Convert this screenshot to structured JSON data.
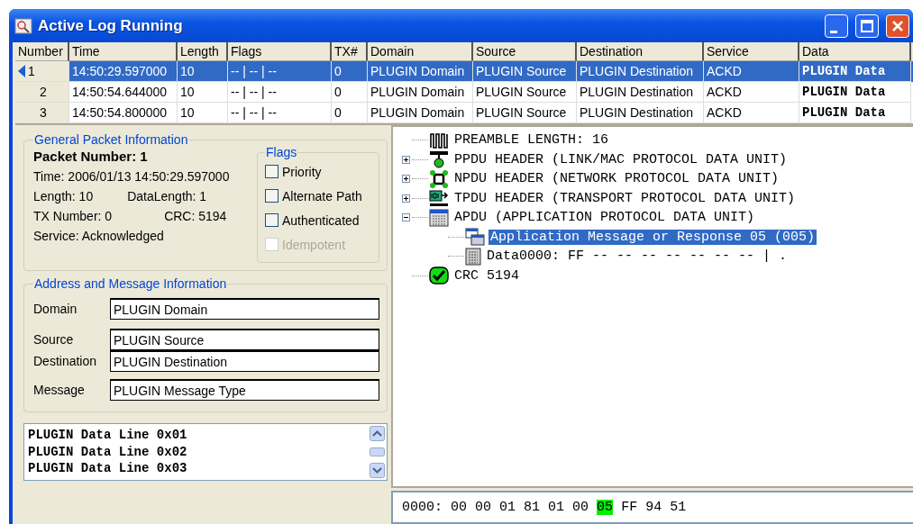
{
  "window": {
    "title": "Active Log Running"
  },
  "table": {
    "columns": [
      "Number",
      "Time",
      "Length",
      "Flags",
      "TX#",
      "Domain",
      "Source",
      "Destination",
      "Service",
      "Data"
    ],
    "rows": [
      {
        "selected": true,
        "cells": [
          "1",
          "14:50:29.597000",
          "10",
          "-- | -- | --",
          "0",
          "PLUGIN Domain",
          "PLUGIN Source",
          "PLUGIN Destination",
          "ACKD",
          "PLUGIN Data"
        ]
      },
      {
        "selected": false,
        "cells": [
          "2",
          "14:50:54.644000",
          "10",
          "-- | -- | --",
          "0",
          "PLUGIN Domain",
          "PLUGIN Source",
          "PLUGIN Destination",
          "ACKD",
          "PLUGIN Data"
        ]
      },
      {
        "selected": false,
        "cells": [
          "3",
          "14:50:54.800000",
          "10",
          "-- | -- | --",
          "0",
          "PLUGIN Domain",
          "PLUGIN Source",
          "PLUGIN Destination",
          "ACKD",
          "PLUGIN Data"
        ]
      }
    ]
  },
  "general": {
    "title": "General Packet Information",
    "packet_number": "Packet Number: 1",
    "time": "Time: 2006/01/13 14:50:29.597000",
    "length": "Length: 10",
    "data_length": "DataLength: 1",
    "tx_number": "TX Number: 0",
    "crc": "CRC: 5194",
    "service": "Service: Acknowledged",
    "flags": {
      "title": "Flags",
      "items": [
        {
          "label": "Priority",
          "checked": false,
          "disabled": false
        },
        {
          "label": "Alternate Path",
          "checked": false,
          "disabled": false
        },
        {
          "label": "Authenticated",
          "checked": false,
          "disabled": false
        },
        {
          "label": "Idempotent",
          "checked": false,
          "disabled": true
        }
      ]
    }
  },
  "address": {
    "title": "Address and Message Information",
    "fields": [
      {
        "label": "Domain",
        "value": "PLUGIN Domain"
      },
      {
        "label": "Source",
        "value": "PLUGIN Source"
      },
      {
        "label": "Destination",
        "value": "PLUGIN Destination"
      },
      {
        "label": "Message",
        "value": "PLUGIN Message Type"
      }
    ]
  },
  "data_lines": [
    "PLUGIN Data Line 0x01",
    "PLUGIN Data Line 0x02",
    "PLUGIN Data Line 0x03"
  ],
  "tree": [
    {
      "kind": "preamble",
      "label": "PREAMBLE LENGTH: 16",
      "selected": false
    },
    {
      "kind": "ppdu",
      "label": "PPDU HEADER (LINK/MAC PROTOCOL DATA UNIT)",
      "selected": false,
      "expanded": false
    },
    {
      "kind": "npdu",
      "label": "NPDU HEADER (NETWORK PROTOCOL DATA UNIT)",
      "selected": false,
      "expanded": false
    },
    {
      "kind": "tpdu",
      "label": "TPDU HEADER (TRANSPORT PROTOCOL DATA UNIT)",
      "selected": false,
      "expanded": false
    },
    {
      "kind": "apdu",
      "label": "APDU (APPLICATION PROTOCOL DATA UNIT)",
      "selected": false,
      "expanded": true,
      "children": [
        {
          "kind": "message",
          "label": "Application Message or Response 05 (005)",
          "selected": true
        },
        {
          "kind": "data",
          "label": "Data0000: FF -- -- -- -- -- -- -- | .",
          "selected": false
        }
      ]
    },
    {
      "kind": "crc",
      "label": "CRC 5194",
      "selected": false
    }
  ],
  "hex": {
    "offset": "0000:",
    "bytes": [
      {
        "text": "00",
        "selected": false
      },
      {
        "text": "00",
        "selected": false
      },
      {
        "text": "01",
        "selected": false
      },
      {
        "text": "81",
        "selected": false
      },
      {
        "text": "01",
        "selected": false
      },
      {
        "text": "00",
        "selected": false
      },
      {
        "text": "05",
        "selected": true
      },
      {
        "text": "FF",
        "selected": false
      },
      {
        "text": "94",
        "selected": false
      },
      {
        "text": "51",
        "selected": false
      }
    ]
  }
}
